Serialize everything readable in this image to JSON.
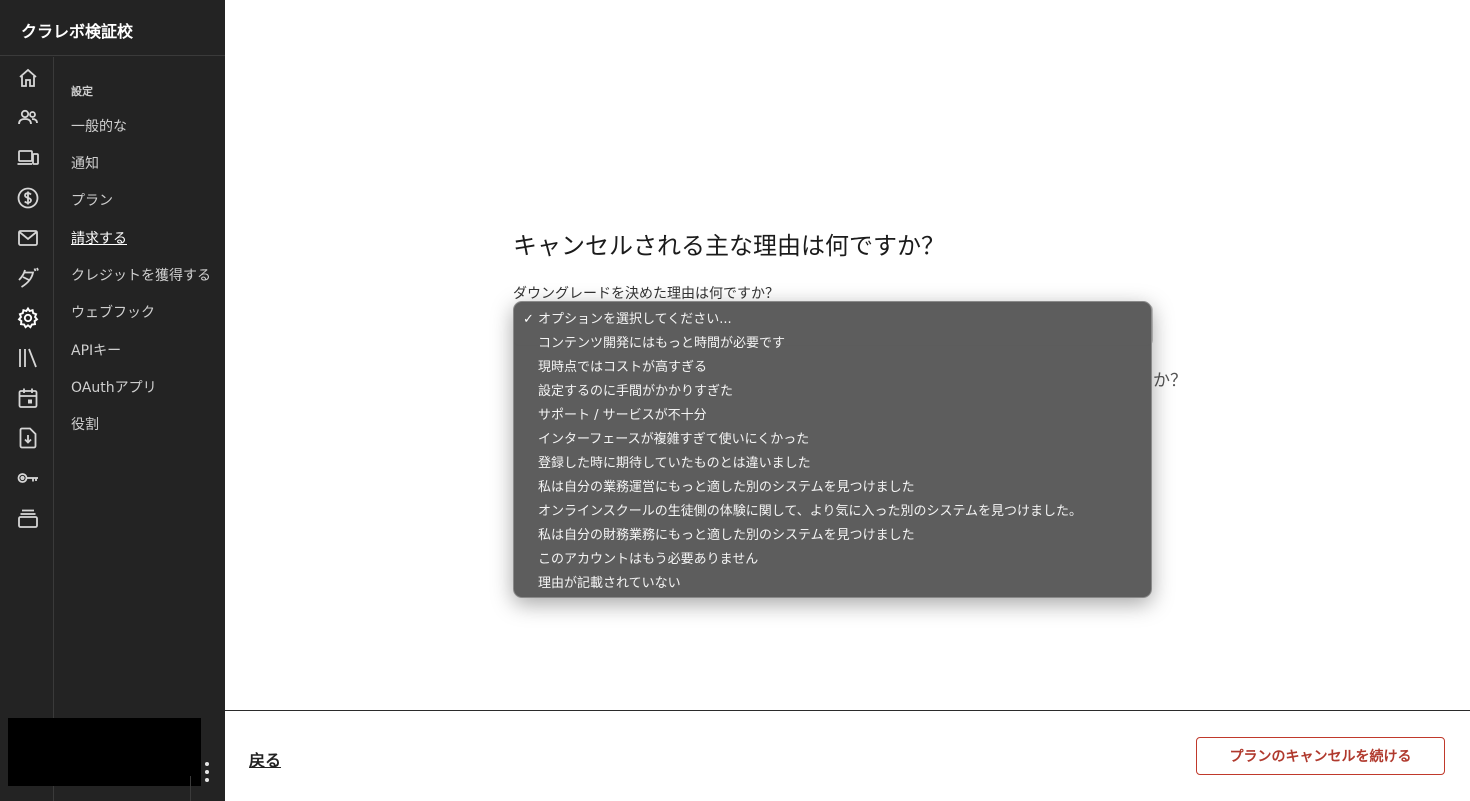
{
  "app": {
    "title": "クラレボ検証校"
  },
  "rail_icons": [
    "home-icon",
    "people-icon",
    "devices-icon",
    "dollar-icon",
    "mail-icon",
    "katakana-da-icon",
    "gear-icon",
    "library-icon",
    "calendar-icon",
    "download-icon",
    "key-icon",
    "stack-icon"
  ],
  "settings_nav": {
    "heading": "設定",
    "items": [
      {
        "label": "一般的な"
      },
      {
        "label": "通知"
      },
      {
        "label": "プラン"
      },
      {
        "label": "請求する",
        "active": true
      },
      {
        "label": "クレジットを獲得する"
      },
      {
        "label": "ウェブフック"
      },
      {
        "label": "APIキー"
      },
      {
        "label": "OAuthアプリ"
      },
      {
        "label": "役割"
      }
    ]
  },
  "survey": {
    "title": "キャンセルされる主な理由は何ですか？",
    "reason_label": "ダウングレードを決めた理由は何ですか？",
    "question2_tail": "か？",
    "dropdown": {
      "selected": "オプションを選択してください...",
      "options": [
        "オプションを選択してください...",
        "コンテンツ開発にはもっと時間が必要です",
        "現時点ではコストが高すぎる",
        "設定するのに手間がかかりすぎた",
        "サポート / サービスが不十分",
        "インターフェースが複雑すぎて使いにくかった",
        "登録した時に期待していたものとは違いました",
        "私は自分の業務運営にもっと適した別のシステムを見つけました",
        "オンラインスクールの生徒側の体験に関して、より気に入った別のシステムを見つけました。",
        "私は自分の財務業務にもっと適した別のシステムを見つけました",
        "このアカウントはもう必要ありません",
        "理由が記載されていない"
      ]
    }
  },
  "footer": {
    "back_label": "戻る",
    "continue_label": "プランのキャンセルを続ける"
  },
  "colors": {
    "sidebar_bg": "#232323",
    "accent_red": "#b0392d",
    "dropdown_bg": "#585858"
  }
}
